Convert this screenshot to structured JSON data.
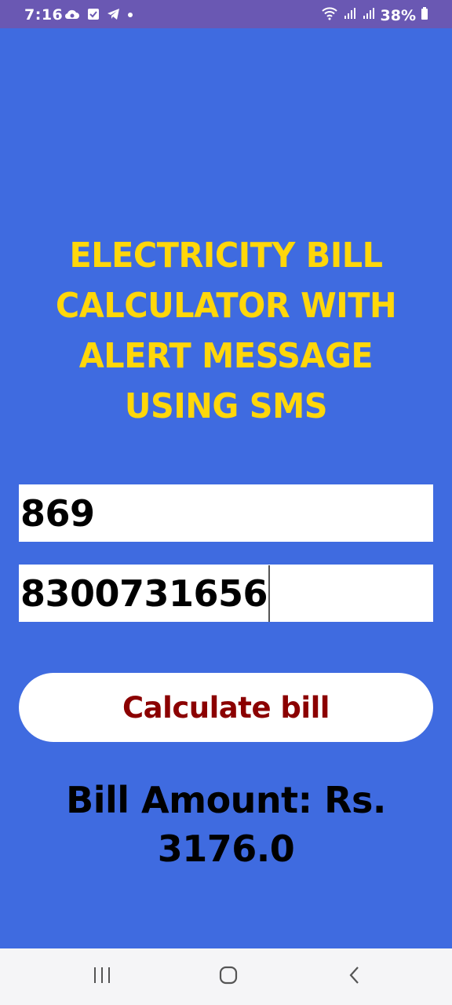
{
  "status_bar": {
    "time": "7:16",
    "left_icons": [
      "cloud-sync-icon",
      "checkbox-icon",
      "telegram-icon",
      "dot-icon"
    ],
    "right_icons": [
      "wifi-icon",
      "signal-icon",
      "signal-icon"
    ],
    "battery": "38%"
  },
  "app": {
    "title": "ELECTRICITY BILL CALCULATOR WITH ALERT MESSAGE USING SMS",
    "units_field": {
      "value": "869"
    },
    "phone_field": {
      "value": "8300731656"
    },
    "calculate_button": {
      "label": "Calculate bill"
    },
    "result": "Bill Amount: Rs. 3176.0"
  },
  "colors": {
    "background": "#3f6be0",
    "status_bar": "#6a58b3",
    "title": "#ffd70a",
    "button_text": "#8b0000"
  },
  "nav_bar": {
    "buttons": [
      "recents-icon",
      "home-icon",
      "back-icon"
    ]
  }
}
